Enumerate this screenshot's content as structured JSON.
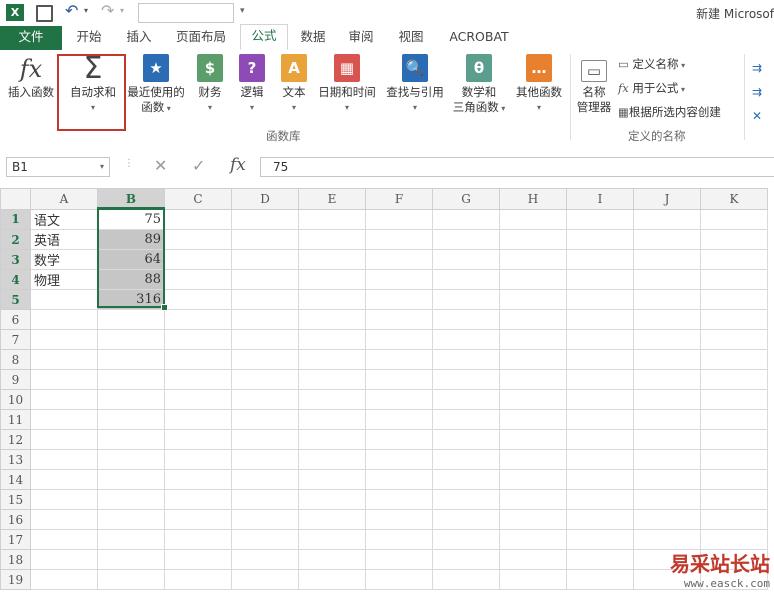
{
  "window": {
    "title": "新建 Microsof"
  },
  "tabs": [
    "文件",
    "开始",
    "插入",
    "页面布局",
    "公式",
    "数据",
    "审阅",
    "视图",
    "ACROBAT"
  ],
  "ribbon": {
    "insert_function": "插入函数",
    "autosum": "自动求和",
    "recent": [
      "最近使用的",
      "函数"
    ],
    "finance": "财务",
    "logic": "逻辑",
    "text": "文本",
    "datetime": "日期和时间",
    "lookup": "查找与引用",
    "math": [
      "数学和",
      "三角函数"
    ],
    "other": "其他函数",
    "name_manager": [
      "名称",
      "管理器"
    ],
    "define_name": "定义名称",
    "use_in_formula": "用于公式",
    "create_from_selection": "根据所选内容创建",
    "group_library": "函数库",
    "group_names": "定义的名称"
  },
  "formula_bar": {
    "name_box": "B1",
    "fx": "fx",
    "value": "75"
  },
  "columns": [
    "A",
    "B",
    "C",
    "D",
    "E",
    "F",
    "G",
    "H",
    "I",
    "J",
    "K"
  ],
  "rows": [
    {
      "n": "1",
      "a": "语文",
      "b": "75"
    },
    {
      "n": "2",
      "a": "英语",
      "b": "89"
    },
    {
      "n": "3",
      "a": "数学",
      "b": "64"
    },
    {
      "n": "4",
      "a": "物理",
      "b": "88"
    },
    {
      "n": "5",
      "a": "",
      "b": "316"
    },
    {
      "n": "6"
    },
    {
      "n": "7"
    },
    {
      "n": "8"
    },
    {
      "n": "9"
    },
    {
      "n": "10"
    },
    {
      "n": "11"
    },
    {
      "n": "12"
    },
    {
      "n": "13"
    },
    {
      "n": "14"
    },
    {
      "n": "15"
    },
    {
      "n": "16"
    },
    {
      "n": "17"
    },
    {
      "n": "18"
    },
    {
      "n": "19"
    }
  ],
  "watermark": {
    "text": "易采站长站",
    "url": "www.easck.com"
  },
  "colors": {
    "excel_green": "#217346",
    "highlight_red": "#c0392b"
  }
}
